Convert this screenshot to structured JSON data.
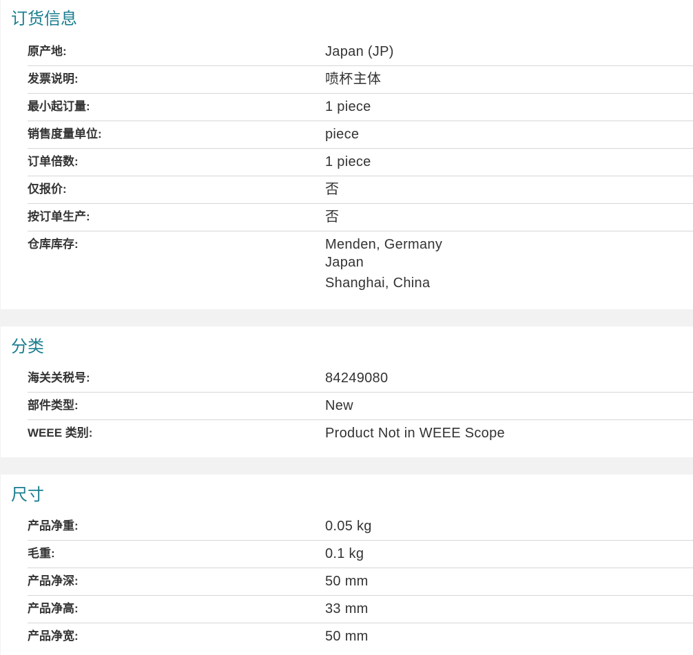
{
  "order_info": {
    "title": "订货信息",
    "rows": [
      {
        "label": "原产地:",
        "value": "Japan (JP)"
      },
      {
        "label": "发票说明:",
        "value": "喷杯主体"
      },
      {
        "label": "最小起订量:",
        "value": "1 piece"
      },
      {
        "label": "销售度量单位:",
        "value": "piece"
      },
      {
        "label": "订单倍数:",
        "value": "1 piece"
      },
      {
        "label": "仅报价:",
        "value": "否"
      },
      {
        "label": "按订单生产:",
        "value": "否"
      },
      {
        "label": "仓库库存:",
        "values": [
          "Menden, Germany",
          "Japan",
          "Shanghai, China"
        ]
      }
    ]
  },
  "classification": {
    "title": "分类",
    "rows": [
      {
        "label": "海关关税号:",
        "value": "84249080"
      },
      {
        "label": "部件类型:",
        "value": "New"
      },
      {
        "label": "WEEE 类别:",
        "value": "Product Not in WEEE Scope"
      }
    ]
  },
  "dimensions": {
    "title": "尺寸",
    "rows": [
      {
        "label": "产品净重:",
        "value": "0.05 kg"
      },
      {
        "label": "毛重:",
        "value": "0.1 kg"
      },
      {
        "label": "产品净深:",
        "value": "50 mm"
      },
      {
        "label": "产品净高:",
        "value": "33 mm"
      },
      {
        "label": "产品净宽:",
        "value": "50 mm"
      }
    ]
  },
  "colors": {
    "accent": "#1a7d8f",
    "text": "#333333",
    "divider": "#d6d6d6",
    "page_background": "#f2f2f2"
  }
}
